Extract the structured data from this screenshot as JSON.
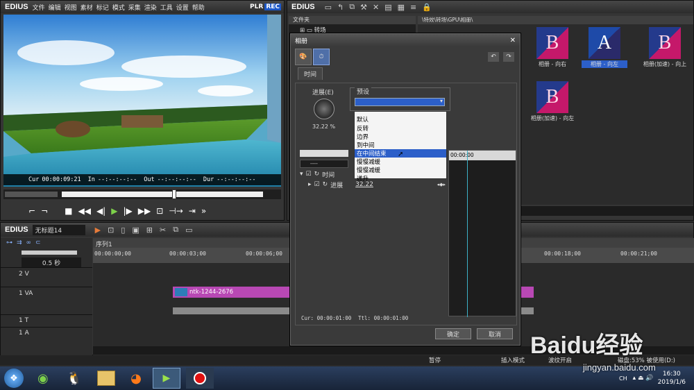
{
  "player": {
    "app": "EDIUS",
    "menus": [
      "文件",
      "编辑",
      "视图",
      "素材",
      "标记",
      "模式",
      "采集",
      "渲染",
      "工具",
      "设置",
      "帮助"
    ],
    "plr": "PLR",
    "rec": "REC",
    "cur_label": "Cur",
    "cur": "00:00:09:21",
    "in_label": "In",
    "in": "--:--:--:--",
    "out_label": "Out",
    "out": "--:--:--:--",
    "dur_label": "Dur",
    "dur": "--:--:--:--"
  },
  "bin": {
    "app": "EDIUS",
    "folder_header": "文件夹",
    "folder_item": "转场",
    "path": "\\特效\\转场\\GPU\\相册\\",
    "items": [
      {
        "label": "相册 - 向右",
        "letter": "B"
      },
      {
        "label": "相册 - 向左",
        "letter": "A"
      },
      {
        "label": "相册(加速) - 向上",
        "letter": "B"
      },
      {
        "label": "相册(加速) - 向左",
        "letter": "B"
      }
    ]
  },
  "dialog": {
    "title": "相册",
    "tab": "时间",
    "progress_label": "进展(E)",
    "progress_value": "32.22 %",
    "preset_label": "预设",
    "options": [
      "默认",
      "反转",
      "边界",
      "到中间",
      "在中间结束",
      "慢慢减缓",
      "慢慢减缓",
      "递升"
    ],
    "selected_index": 4,
    "tree_dashes": "----",
    "tree_row1": "时间",
    "tree_row2": "进展",
    "tree_row2_value": "32.22",
    "ruler_time": "00:00:00",
    "cur_label": "Cur: 00:00:01:00",
    "ttl_label": "Ttl: 00:00:01:00",
    "ok": "确定",
    "cancel": "取消"
  },
  "timeline": {
    "app": "EDIUS",
    "project": "无标题14",
    "sequence": "序列1",
    "scale": "0.5 秒",
    "ruler": [
      "00:00:00;00",
      "00:00:03;00",
      "00:00:06;00",
      "00:00:18;00",
      "00:00:21;00"
    ],
    "tracks": [
      "2 V",
      "1 VA",
      "1 T",
      "1 A"
    ],
    "clip": "ntk-1244-2676"
  },
  "status": {
    "pause": "暂停",
    "insert": "插入模式",
    "wave": "波纹开启",
    "disk": "磁盘:53% 被使用(D:)"
  },
  "taskbar": {
    "time": "16:30",
    "date": "2019/1/6",
    "ch": "CH"
  },
  "watermark": {
    "brand": "Baidu经验",
    "url": "jingyan.baidu.com"
  }
}
